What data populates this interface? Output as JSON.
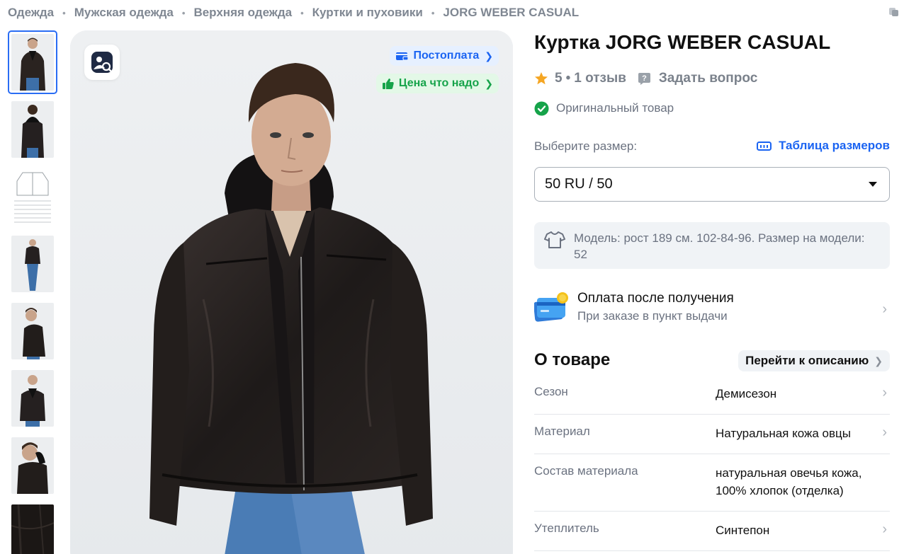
{
  "breadcrumb": [
    "Одежда",
    "Мужская одежда",
    "Верхняя одежда",
    "Куртки и пуховики",
    "JORG WEBER CASUAL"
  ],
  "breadcrumb_separator": "•",
  "badges": {
    "postpay": "Постоплата",
    "price": "Цена что надо"
  },
  "product": {
    "title": "Куртка JORG WEBER CASUAL",
    "rating": "5",
    "reviews": "1 отзыв",
    "rating_separator": "•",
    "ask": "Задать вопрос",
    "original": "Оригинальный товар"
  },
  "size": {
    "label": "Выберите размер:",
    "table_link": "Таблица размеров",
    "selected": "50 RU / 50"
  },
  "model_info": "Модель: рост 189 см. 102-84-96. Размер на модели: 52",
  "payment": {
    "title": "Оплата после получения",
    "subtitle": "При заказе в пункт выдачи"
  },
  "about": {
    "title": "О товаре",
    "goto": "Перейти к описанию",
    "specs": [
      {
        "key": "Сезон",
        "value": "Демисезон"
      },
      {
        "key": "Материал",
        "value": "Натуральная кожа овцы"
      },
      {
        "key": "Состав материала",
        "value": "натуральная овечья кожа, 100% хлопок (отделка)"
      },
      {
        "key": "Утеплитель",
        "value": "Синтепон"
      }
    ]
  },
  "icons": {
    "copy": "copy-icon",
    "image_search": "image-search-icon",
    "wallet": "wallet-icon",
    "thumbs_up": "thumbs-up-icon",
    "star": "star-icon",
    "question": "question-icon",
    "check": "check-circle-icon",
    "ruler": "ruler-icon",
    "shirt": "shirt-icon",
    "cards": "payment-cards-icon"
  },
  "colors": {
    "accent": "#1b64f2",
    "success": "#16a34a",
    "star": "#f5a623",
    "muted": "#6b7280"
  }
}
